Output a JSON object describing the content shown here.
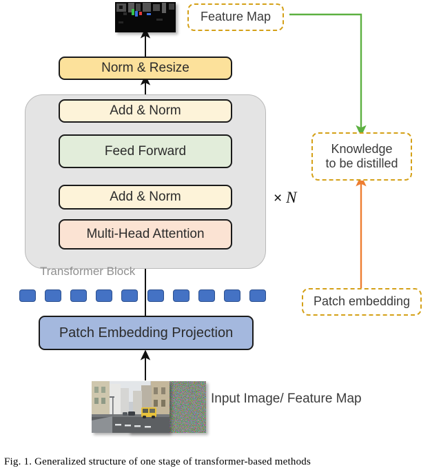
{
  "figure": {
    "caption": "Fig. 1.    Generalized structure of one stage of transformer-based methods"
  },
  "pipeline": {
    "output_feature_map_label": "Feature Map",
    "norm_resize": "Norm & Resize",
    "add_norm_top": "Add & Norm",
    "feed_forward": "Feed Forward",
    "add_norm_bottom": "Add & Norm",
    "multi_head_attention": "Multi-Head Attention",
    "transformer_block_label": "Transformer Block",
    "repeat_label": "× ",
    "repeat_count": "N",
    "patch_embedding_projection": "Patch Embedding Projection",
    "input_label": "Input Image/ Feature Map"
  },
  "distillation": {
    "knowledge_line1": "Knowledge",
    "knowledge_line2": "to be distilled",
    "patch_embedding": "Patch embedding"
  },
  "patches": {
    "count": 10,
    "color": "#4472C4"
  },
  "colors": {
    "norm_resize_fill": "#FCE19B",
    "add_norm_fill": "#FDF3D9",
    "feed_forward_fill": "#E2EDDA",
    "attention_fill": "#FBE3D3",
    "projection_fill": "#A4B8DE",
    "transformer_block_fill": "#E4E4E4",
    "dashed_border": "#D4A017",
    "green_arrow": "#5CB040",
    "orange_arrow": "#ED7D31",
    "black_arrow": "#111111"
  }
}
